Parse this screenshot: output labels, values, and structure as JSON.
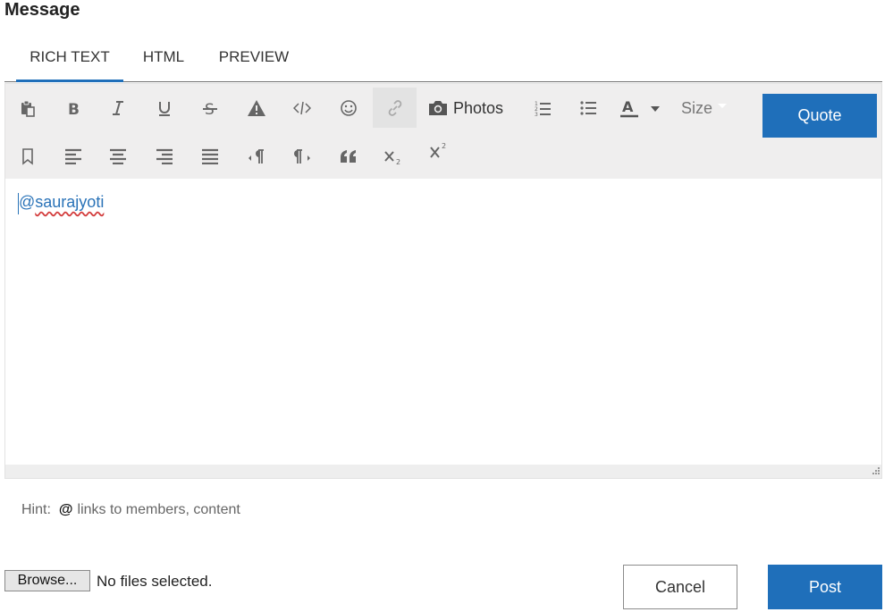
{
  "title": "Message",
  "tabs": [
    {
      "label": "RICH TEXT",
      "active": true
    },
    {
      "label": "HTML",
      "active": false
    },
    {
      "label": "PREVIEW",
      "active": false
    }
  ],
  "toolbar": {
    "photos_label": "Photos",
    "size_label": "Size",
    "quote_label": "Quote",
    "icons": [
      "paste-icon",
      "bold-icon",
      "italic-icon",
      "underline-icon",
      "strikethrough-icon",
      "spoiler-warning-icon",
      "code-icon",
      "emoji-icon",
      "link-icon",
      "camera-icon",
      "ordered-list-icon",
      "unordered-list-icon",
      "font-color-icon",
      "bookmark-icon",
      "align-left-icon",
      "align-center-icon",
      "align-right-icon",
      "align-justify-icon",
      "ltr-paragraph-icon",
      "rtl-paragraph-icon",
      "blockquote-icon",
      "subscript-icon",
      "superscript-icon"
    ]
  },
  "editor": {
    "content_at": "@",
    "content_name": "saurajyoti"
  },
  "hint": {
    "prefix": "Hint:",
    "symbol": "@",
    "text": "links to members, content"
  },
  "attachment": {
    "browse_label": "Browse...",
    "status": "No files selected."
  },
  "actions": {
    "cancel_label": "Cancel",
    "post_label": "Post"
  },
  "colors": {
    "accent": "#1f6fba",
    "toolbar_bg": "#efeeee",
    "mention": "#2a73b8"
  }
}
